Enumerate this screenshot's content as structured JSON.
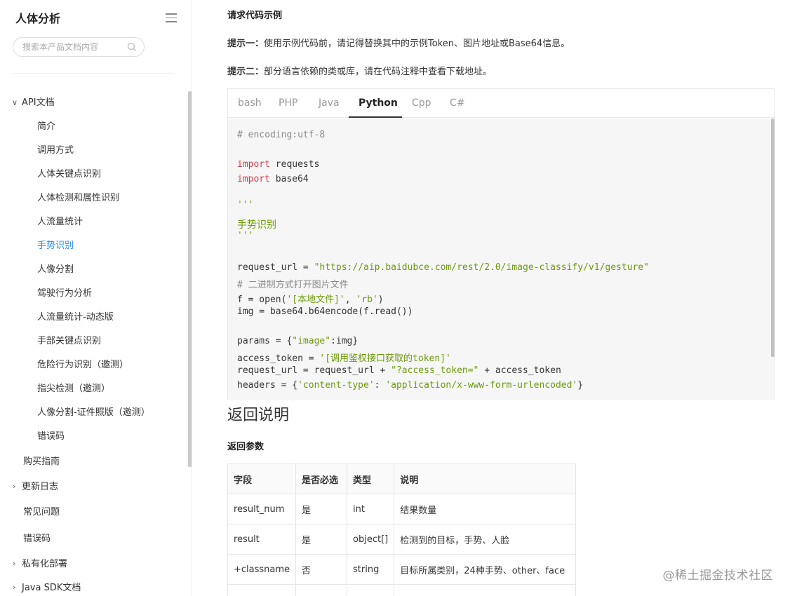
{
  "sidebar": {
    "title": "人体分析",
    "search_placeholder": "搜索本产品文档内容",
    "items": [
      {
        "label": "API文档",
        "level": 0,
        "caret": "expanded"
      },
      {
        "label": "简介",
        "level": 1
      },
      {
        "label": "调用方式",
        "level": 1
      },
      {
        "label": "人体关键点识别",
        "level": 1
      },
      {
        "label": "人体检测和属性识别",
        "level": 1
      },
      {
        "label": "人流量统计",
        "level": 1
      },
      {
        "label": "手势识别",
        "level": 1,
        "active": true
      },
      {
        "label": "人像分割",
        "level": 1
      },
      {
        "label": "驾驶行为分析",
        "level": 1
      },
      {
        "label": "人流量统计-动态版",
        "level": 1
      },
      {
        "label": "手部关键点识别",
        "level": 1
      },
      {
        "label": "危险行为识别（邀测）",
        "level": 1
      },
      {
        "label": "指尖检测（邀测）",
        "level": 1
      },
      {
        "label": "人像分割-证件照版（邀测）",
        "level": 1
      },
      {
        "label": "错误码",
        "level": 1
      },
      {
        "label": "购买指南",
        "level": 0
      },
      {
        "label": "更新日志",
        "level": 0,
        "caret": "collapsed"
      },
      {
        "label": "常见问题",
        "level": 0
      },
      {
        "label": "错误码",
        "level": 0
      },
      {
        "label": "私有化部署",
        "level": 0,
        "caret": "collapsed"
      },
      {
        "label": "Java SDK文档",
        "level": 0,
        "caret": "collapsed"
      }
    ]
  },
  "main": {
    "section_title": "请求代码示例",
    "tip1_label": "提示一：",
    "tip1_text": "使用示例代码前，请记得替换其中的示例Token、图片地址或Base64信息。",
    "tip2_label": "提示二：",
    "tip2_text": "部分语言依赖的类或库，请在代码注释中查看下载地址。",
    "tabs": [
      "bash",
      "PHP",
      "Java",
      "Python",
      "Cpp",
      "C#"
    ],
    "active_tab": "Python",
    "code": {
      "l1": "# encoding:utf-8",
      "l2_kw": "import",
      "l2": " requests",
      "l3_kw": "import",
      "l3": " base64",
      "l4": "'''",
      "l5": "手势识别",
      "l6": "'''",
      "l7_a": "request_url = ",
      "l7_s": "\"https://aip.baidubce.com/rest/2.0/image-classify/v1/gesture\"",
      "l8": "# 二进制方式打开图片文件",
      "l9_a": "f = open(",
      "l9_s1": "'[本地文件]'",
      "l9_b": ", ",
      "l9_s2": "'rb'",
      "l9_c": ")",
      "l10": "img = base64.b64encode(f.read())",
      "l11_a": "params = {",
      "l11_s": "\"image\"",
      "l11_b": ":img}",
      "l12_a": "access_token = ",
      "l12_s": "'[调用鉴权接口获取的token]'",
      "l13_a": "request_url = request_url + ",
      "l13_s": "\"?access_token=\"",
      "l13_b": " + access_token",
      "l14_a": "headers = {",
      "l14_s1": "'content-type'",
      "l14_b": ": ",
      "l14_s2": "'application/x-www-form-urlencoded'",
      "l14_c": "}"
    },
    "return_title": "返回说明",
    "return_params_title": "返回参数",
    "table": {
      "headers": [
        "字段",
        "是否必选",
        "类型",
        "说明"
      ],
      "rows": [
        [
          "result_num",
          "是",
          "int",
          "结果数量"
        ],
        [
          "result",
          "是",
          "object[]",
          "检测到的目标，手势、人脸"
        ],
        [
          "+classname",
          "否",
          "string",
          "目标所属类别，24种手势、other、face"
        ]
      ]
    }
  },
  "watermark": "@稀土掘金技术社区",
  "colors": {
    "accent": "#2d8cf0",
    "code_bg": "#f6f6f6",
    "keyword": "#d73a49",
    "string": "#6b9a0a",
    "comment": "#888888"
  }
}
